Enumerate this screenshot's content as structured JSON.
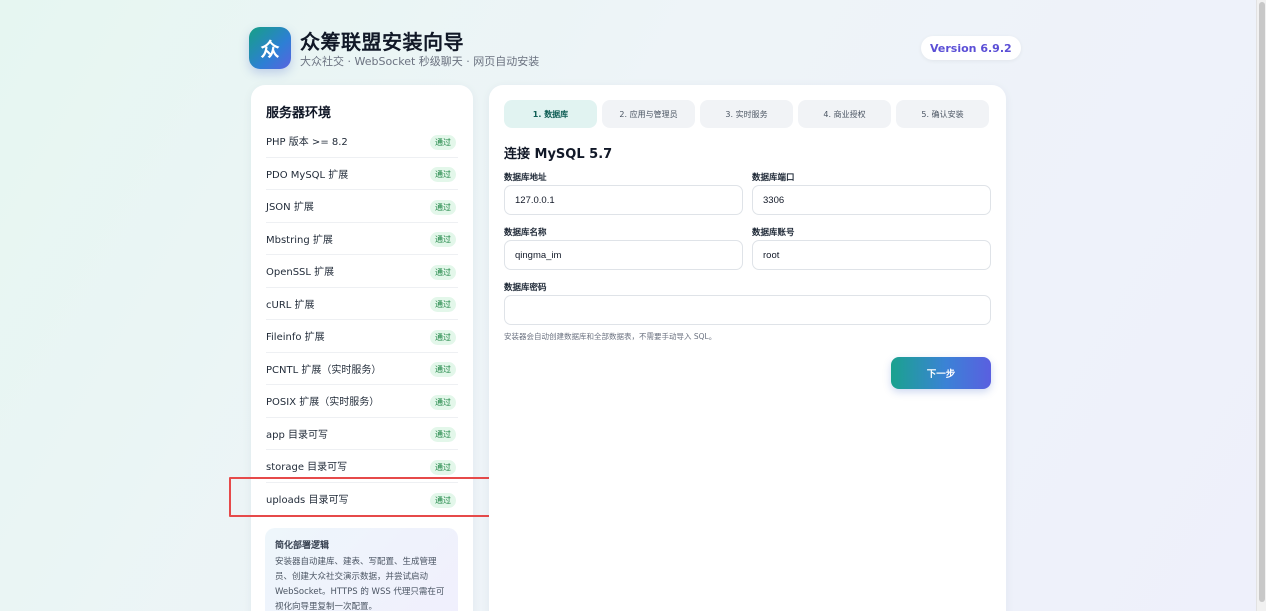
{
  "header": {
    "logo_glyph": "众",
    "title": "众筹联盟安装向导",
    "subtitle": "大众社交 · WebSocket 秒级聊天 · 网页自动安装",
    "version": "Version 6.9.2"
  },
  "env": {
    "title": "服务器环境",
    "items": [
      {
        "label": "PHP 版本 >= 8.2",
        "status": "通过"
      },
      {
        "label": "PDO MySQL 扩展",
        "status": "通过"
      },
      {
        "label": "JSON 扩展",
        "status": "通过"
      },
      {
        "label": "Mbstring 扩展",
        "status": "通过"
      },
      {
        "label": "OpenSSL 扩展",
        "status": "通过"
      },
      {
        "label": "cURL 扩展",
        "status": "通过"
      },
      {
        "label": "Fileinfo 扩展",
        "status": "通过"
      },
      {
        "label": "PCNTL 扩展（实时服务）",
        "status": "通过"
      },
      {
        "label": "POSIX 扩展（实时服务）",
        "status": "通过"
      },
      {
        "label": "app 目录可写",
        "status": "通过"
      },
      {
        "label": "storage 目录可写",
        "status": "通过"
      },
      {
        "label": "uploads 目录可写",
        "status": "通过"
      }
    ],
    "note": {
      "title": "简化部署逻辑",
      "body": "安装器自动建库、建表、写配置、生成管理员、创建大众社交演示数据，并尝试启动 WebSocket。HTTPS 的 WSS 代理只需在可视化向导里复制一次配置。"
    }
  },
  "steps": [
    {
      "label": "1. 数据库",
      "active": true
    },
    {
      "label": "2. 应用与管理员",
      "active": false
    },
    {
      "label": "3. 实时服务",
      "active": false
    },
    {
      "label": "4. 商业授权",
      "active": false
    },
    {
      "label": "5. 确认安装",
      "active": false
    }
  ],
  "form": {
    "title": "连接 MySQL 5.7",
    "host_label": "数据库地址",
    "host_value": "127.0.0.1",
    "port_label": "数据库端口",
    "port_value": "3306",
    "name_label": "数据库名称",
    "name_value": "qingma_im",
    "user_label": "数据库账号",
    "user_value": "root",
    "password_label": "数据库密码",
    "password_value": "",
    "hint": "安装器会自动创建数据库和全部数据表，不需要手动导入 SQL。",
    "next_label": "下一步"
  }
}
